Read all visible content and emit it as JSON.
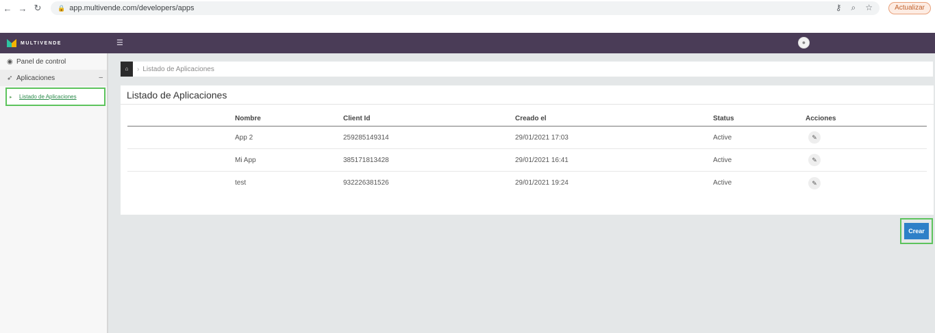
{
  "browser": {
    "url": "app.multivende.com/developers/apps",
    "update_label": "Actualizar"
  },
  "header": {
    "logo_text": "MULTIVENDE"
  },
  "sidebar": {
    "items": [
      {
        "label": "Panel de control"
      },
      {
        "label": "Aplicaciones"
      }
    ],
    "sub_items": [
      {
        "label": "Listado de Aplicaciones"
      }
    ]
  },
  "breadcrumb": {
    "current": "Listado de Aplicaciones"
  },
  "panel": {
    "title": "Listado de Aplicaciones",
    "columns": [
      "Nombre",
      "Client Id",
      "Creado el",
      "Status",
      "Acciones"
    ],
    "rows": [
      {
        "name": "App 2",
        "client_id": "259285149314",
        "created": "29/01/2021 17:03",
        "status": "Active"
      },
      {
        "name": "Mi App",
        "client_id": "385171813428",
        "created": "29/01/2021 16:41",
        "status": "Active"
      },
      {
        "name": "test",
        "client_id": "932226381526",
        "created": "29/01/2021 19:24",
        "status": "Active"
      }
    ]
  },
  "actions": {
    "create_label": "Crear"
  },
  "colors": {
    "header_bg": "#4a3c57",
    "primary_button": "#2e80c8",
    "highlight_border": "#5cc35c"
  }
}
